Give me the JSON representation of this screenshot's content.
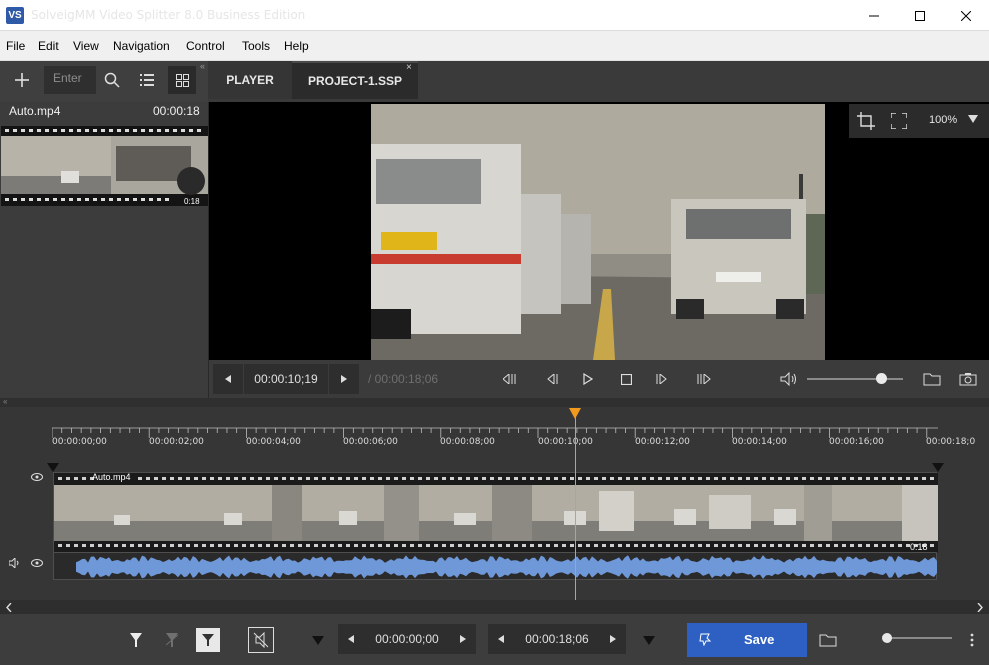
{
  "window": {
    "title": "SolveigMM Video Splitter 8.0 Business Edition",
    "app_icon_text": "VS"
  },
  "menu": [
    "File",
    "Edit",
    "View",
    "Navigation",
    "Control",
    "Tools",
    "Help"
  ],
  "toolbar": {
    "search_placeholder": "Enter"
  },
  "tabs": [
    {
      "label": "PLAYER"
    },
    {
      "label": "PROJECT-1.SSP"
    }
  ],
  "media": {
    "file_name": "Auto.mp4",
    "duration": "00:00:18",
    "thumb_duration": "0:18"
  },
  "player": {
    "zoom": "100%",
    "current_time": "00:00:10;19",
    "total_time": "/ 00:00:18;06",
    "volume": 0.77
  },
  "timeline": {
    "ticks": [
      "00:00:00;00",
      "00:00:02;00",
      "00:00:04;00",
      "00:00:06;00",
      "00:00:08;00",
      "00:00:10;00",
      "00:00:12;00",
      "00:00:14;00",
      "00:00:16;00",
      "00:00:18;0"
    ],
    "track_name": "Auto.mp4",
    "track_end_label": "0:18",
    "playhead_time": "00:00:10;19"
  },
  "bottom": {
    "start_time": "00:00:00;00",
    "end_time": "00:00:18;06",
    "save_label": "Save"
  },
  "colors": {
    "accent": "#2d60c2",
    "playhead": "#f19a1d",
    "waveform": "#6f98d8"
  }
}
